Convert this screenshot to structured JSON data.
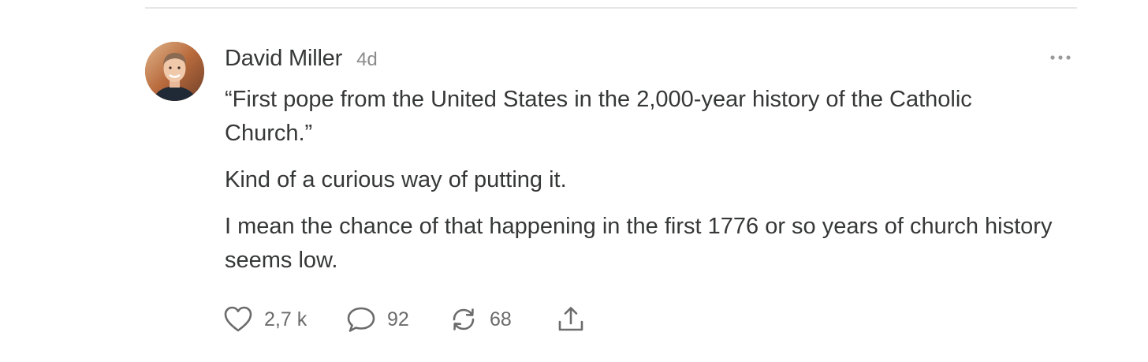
{
  "comment": {
    "author": "David Miller",
    "timestamp": "4d",
    "avatar_icon": "user-avatar-photo",
    "paragraphs": [
      "“First pope from the United States in the 2,000-year history of the Catholic Church.”",
      "Kind of a curious way of putting it.",
      "I mean the chance of that happening in the first 1776 or so years of church history seems low."
    ],
    "actions": {
      "like": {
        "icon": "heart-icon",
        "count": "2,7 k"
      },
      "reply": {
        "icon": "speech-bubble-icon",
        "count": "92"
      },
      "restack": {
        "icon": "restack-icon",
        "count": "68"
      },
      "share": {
        "icon": "share-icon"
      }
    },
    "more_icon": "more-options-icon"
  },
  "colors": {
    "text": "#363737",
    "muted": "#8b8b8b",
    "icon": "#6b6b6b",
    "divider": "#e6e6e6"
  }
}
